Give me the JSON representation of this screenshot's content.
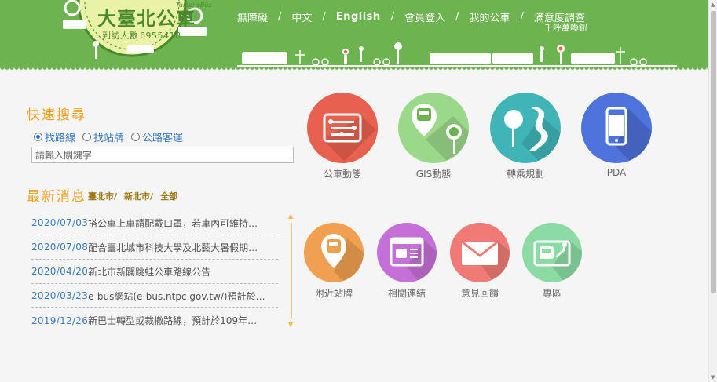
{
  "header": {
    "logo_title": "大臺北公車",
    "logo_subtitle": "Taipei eBus",
    "visits_label": "到訪人數",
    "visits_count": "6955418",
    "nav": [
      "無障礙",
      "中文",
      "English",
      "會員登入",
      "我的公車",
      "滿意度調查"
    ],
    "nav_separator": "/",
    "note": "千呼萬喚鈕"
  },
  "quick_search": {
    "title": "快速搜尋",
    "options": [
      "找路線",
      "找站牌",
      "公路客運"
    ],
    "selected": "找路線",
    "placeholder": "請輸入關鍵字"
  },
  "news": {
    "title": "最新消息",
    "filters": [
      "臺北市/",
      "新北市/",
      "全部"
    ],
    "items": [
      {
        "date": "2020/07/03",
        "text": "搭公車上車請配戴口罩，若車內可維持…"
      },
      {
        "date": "2020/07/08",
        "text": "配合臺北城市科技大學及北藝大暑假期…"
      },
      {
        "date": "2020/04/20",
        "text": "新北市新闢跳蛙公車路線公告"
      },
      {
        "date": "2020/03/23",
        "text": "e-bus網站(e-bus.ntpc.gov.tw/)預計於…"
      },
      {
        "date": "2019/12/26",
        "text": "新巴士轉型或裁撤路線，預計於109年…"
      }
    ]
  },
  "services": [
    {
      "label": "公車動態",
      "icon": "bus-dashboard-icon",
      "color": "#e8604f"
    },
    {
      "label": "GIS動態",
      "icon": "bus-stop-map-icon",
      "color": "#9ad88a"
    },
    {
      "label": "轉乘規劃",
      "icon": "route-road-icon",
      "color": "#3fb5b8"
    },
    {
      "label": "PDA",
      "icon": "smartphone-icon",
      "color": "#4f73dd"
    },
    {
      "label": "附近站牌",
      "icon": "location-bus-icon",
      "color": "#f0a050"
    },
    {
      "label": "相關連結",
      "icon": "browser-bus-icon",
      "color": "#c470d8"
    },
    {
      "label": "意見回饋",
      "icon": "mail-envelope-icon",
      "color": "#f07b76"
    },
    {
      "label": "專區",
      "icon": "bus-map-icon",
      "color": "#8ddba4"
    }
  ]
}
